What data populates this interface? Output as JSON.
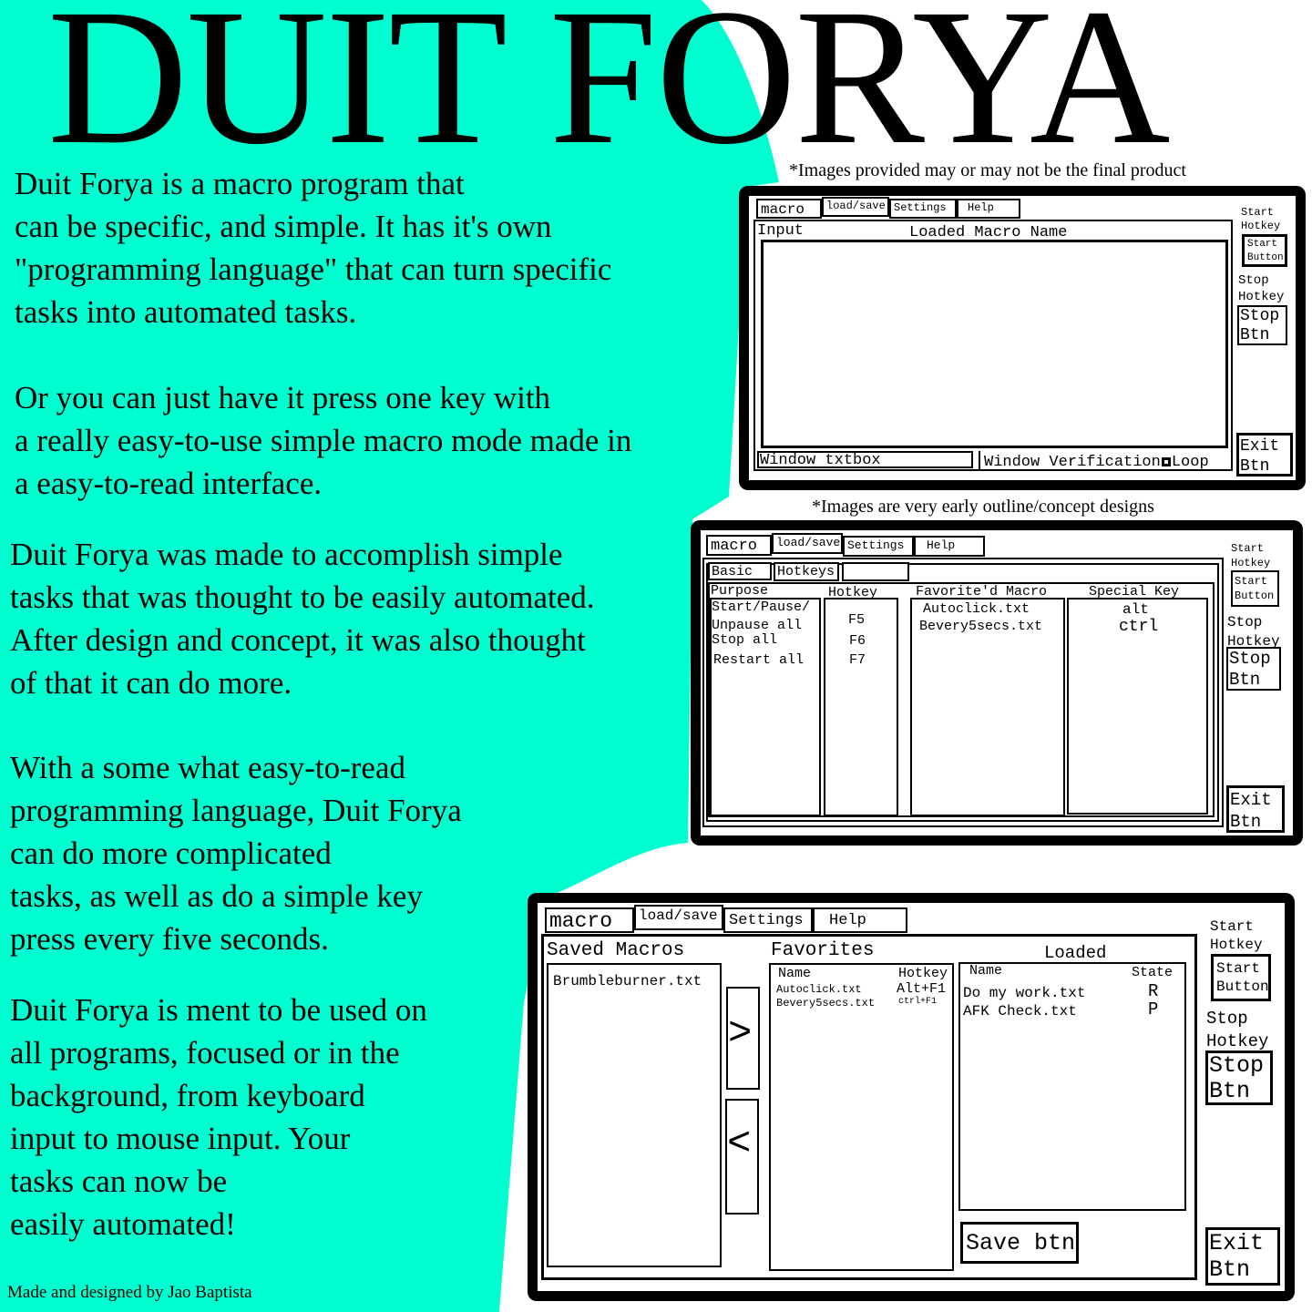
{
  "colors": {
    "accent": "#00ffd0",
    "ink": "#000000",
    "paper": "#ffffff"
  },
  "title": "DUIT FORYA",
  "intro": {
    "lines": [
      "Duit Forya is a macro program that",
      "can be specific, and simple. It has it's own",
      "\"programming language\" that can turn specific",
      "tasks into automated tasks."
    ]
  },
  "simple": {
    "lines": [
      "Or you can just have it press one key with",
      "a really easy-to-use simple macro mode made in",
      "a easy-to-read interface."
    ]
  },
  "purpose": {
    "lines": [
      "Duit Forya was made to accomplish simple",
      "tasks that was thought to be easily automated.",
      "After design and concept, it was also thought",
      "of that it can do more."
    ]
  },
  "language": {
    "lines": [
      "With a some what easy-to-read",
      "programming language, Duit Forya",
      "can do more complicated",
      "tasks, as well as do a simple key",
      "press every five seconds."
    ]
  },
  "usage": {
    "lines": [
      "Duit Forya is ment to be used on",
      "all programs, focused or in the",
      "background, from keyboard",
      "input to mouse input. Your",
      "tasks can now be",
      "easily automated!"
    ]
  },
  "notes": {
    "images_final": "*Images provided may or may not be the final product",
    "early_concept": "*Images are very early outline/concept designs"
  },
  "credit": "Made and designed by Jao Baptista",
  "mockup1": {
    "tabs": [
      "macro",
      "load/save",
      "Settings",
      "Help"
    ],
    "input_label": "Input",
    "loaded_label": "Loaded Macro Name",
    "window_textbox": "Window txtbox",
    "window_verification": "Window Verification",
    "loop_label": "Loop",
    "start_hotkey": [
      "Start",
      "Hotkey"
    ],
    "start_button": [
      "Start",
      "Button"
    ],
    "stop_hotkey": [
      "Stop",
      "Hotkey"
    ],
    "stop_button": [
      "Stop",
      "Btn"
    ],
    "exit_button": [
      "Exit",
      "Btn"
    ]
  },
  "mockup2": {
    "tabs": [
      "macro",
      "load/save",
      "Settings",
      "Help"
    ],
    "subtabs": [
      "Basic",
      "Hotkeys",
      ""
    ],
    "columns": [
      "Purpose",
      "Hotkey",
      "Favorite'd Macro",
      "Special Key"
    ],
    "purpose_items": [
      "Start/Pause/",
      "Unpause all",
      "Stop all",
      "Restart all"
    ],
    "hotkey_items": [
      "F5",
      "F6",
      "F7"
    ],
    "favorite_items": [
      "Autoclick.txt",
      "Bevery5secs.txt"
    ],
    "special_items": [
      "alt",
      "ctrl"
    ],
    "start_hotkey": [
      "Start",
      "Hotkey"
    ],
    "start_button": [
      "Start",
      "Button"
    ],
    "stop_hotkey": [
      "Stop",
      "Hotkey"
    ],
    "stop_button": [
      "Stop",
      "Btn"
    ],
    "exit_button": [
      "Exit",
      "Btn"
    ]
  },
  "mockup3": {
    "tabs": [
      "macro",
      "load/save",
      "Settings",
      "Help"
    ],
    "saved_label": "Saved Macros",
    "saved_items": [
      "Brumbleburner.txt"
    ],
    "move_right": ">",
    "move_left": "<",
    "favorites_label": "Favorites",
    "fav_name_header": "Name",
    "fav_hotkey_header": "Hotkey",
    "favorites": [
      {
        "name": "Autoclick.txt",
        "hotkey": "Alt+F1"
      },
      {
        "name": "Bevery5secs.txt",
        "hotkey": "ctrl+F1"
      }
    ],
    "loaded_label": "Loaded",
    "loaded_name_header": "Name",
    "loaded_state_header": "State",
    "loaded": [
      {
        "name": "Do my work.txt",
        "state": "R"
      },
      {
        "name": "AFK Check.txt",
        "state": "P"
      }
    ],
    "save_button": "Save btn",
    "start_hotkey": [
      "Start",
      "Hotkey"
    ],
    "start_button": [
      "Start",
      "Button"
    ],
    "stop_hotkey": [
      "Stop",
      "Hotkey"
    ],
    "stop_button": [
      "Stop",
      "Btn"
    ],
    "exit_button": [
      "Exit",
      "Btn"
    ]
  }
}
